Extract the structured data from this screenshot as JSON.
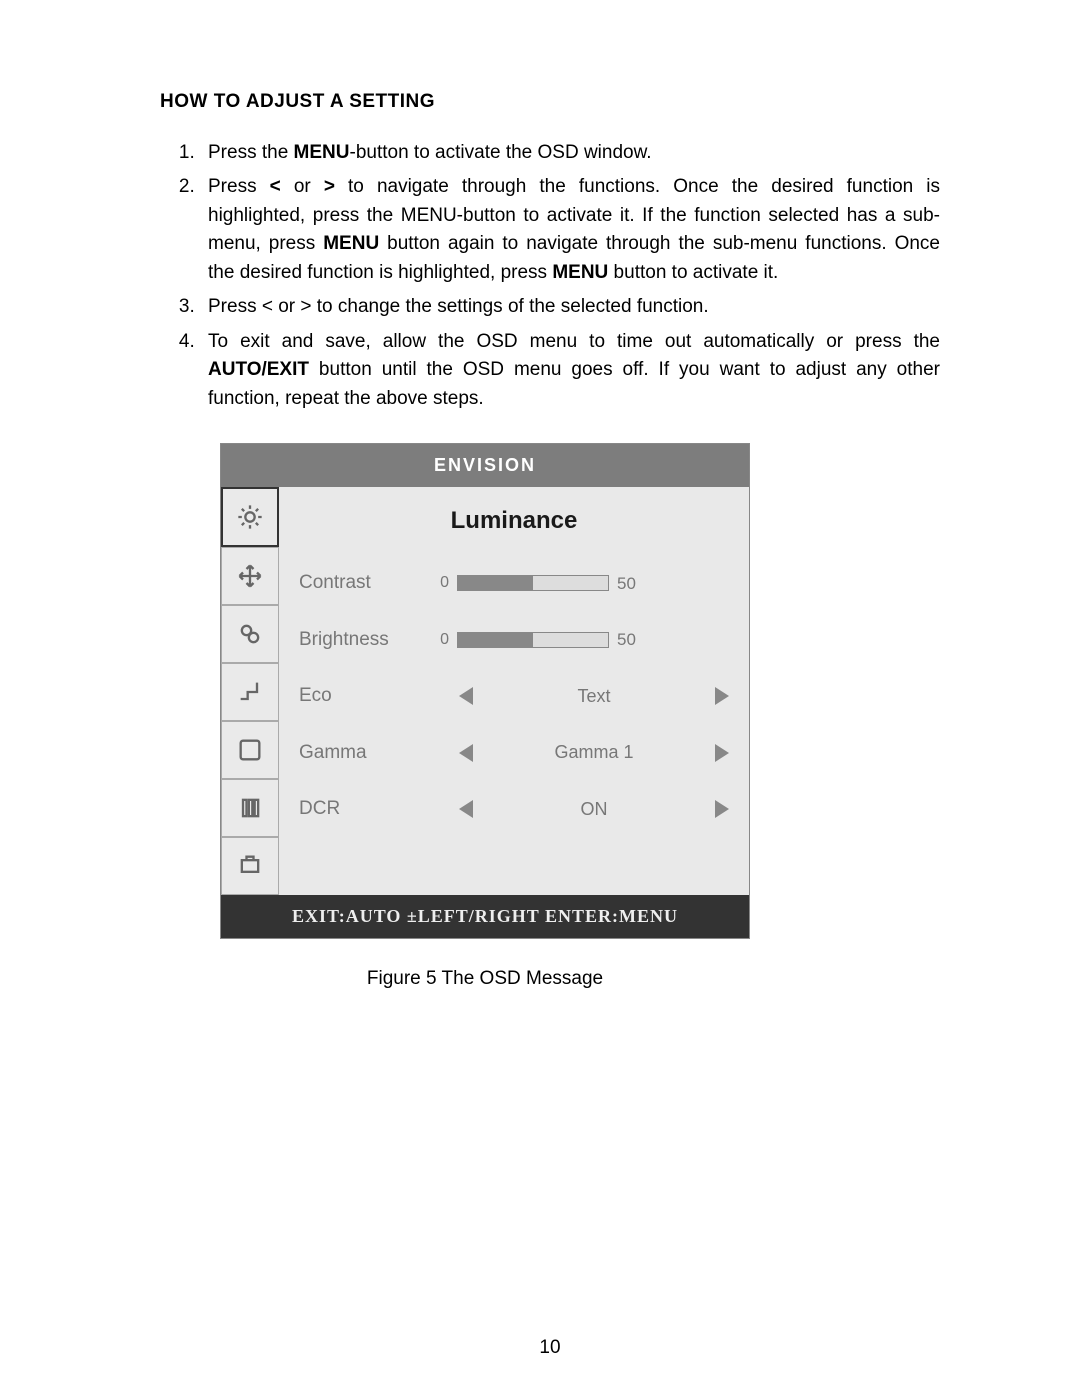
{
  "heading": "HOW TO ADJUST A SETTING",
  "steps": {
    "s1a": "Press the ",
    "s1b": "MENU",
    "s1c": "-button to activate the OSD window.",
    "s2a": "Press  ",
    "s2b": "<",
    "s2c": " or ",
    "s2d": ">",
    "s2e": "  to navigate through the functions. Once the desired function is highlighted, press the MENU-button to activate it.  If the function selected has a sub-menu, press ",
    "s2f": "MENU",
    "s2g": " button again to navigate through the sub-menu functions.   Once the desired function is highlighted, press ",
    "s2h": "MENU",
    "s2i": " button to activate it.",
    "s3": "Press < or > to change the settings of the selected function.",
    "s4a": "To exit and save, allow the OSD menu to time out automatically or press the ",
    "s4b": "AUTO/EXIT",
    "s4c": " button until the OSD menu goes off. If you want to adjust any other function, repeat the above steps."
  },
  "osd": {
    "title": "ENVISION",
    "panel": "Luminance",
    "contrast_label": "Contrast",
    "contrast_zero": "0",
    "contrast_value": "50",
    "brightness_label": "Brightness",
    "brightness_zero": "0",
    "brightness_value": "50",
    "eco_label": "Eco",
    "eco_value": "Text",
    "gamma_label": "Gamma",
    "gamma_value": "Gamma 1",
    "dcr_label": "DCR",
    "dcr_value": "ON",
    "footer": "EXIT:AUTO ±LEFT/RIGHT  ENTER:MENU"
  },
  "caption": "Figure 5     The  OSD  Message",
  "page_number": "10"
}
